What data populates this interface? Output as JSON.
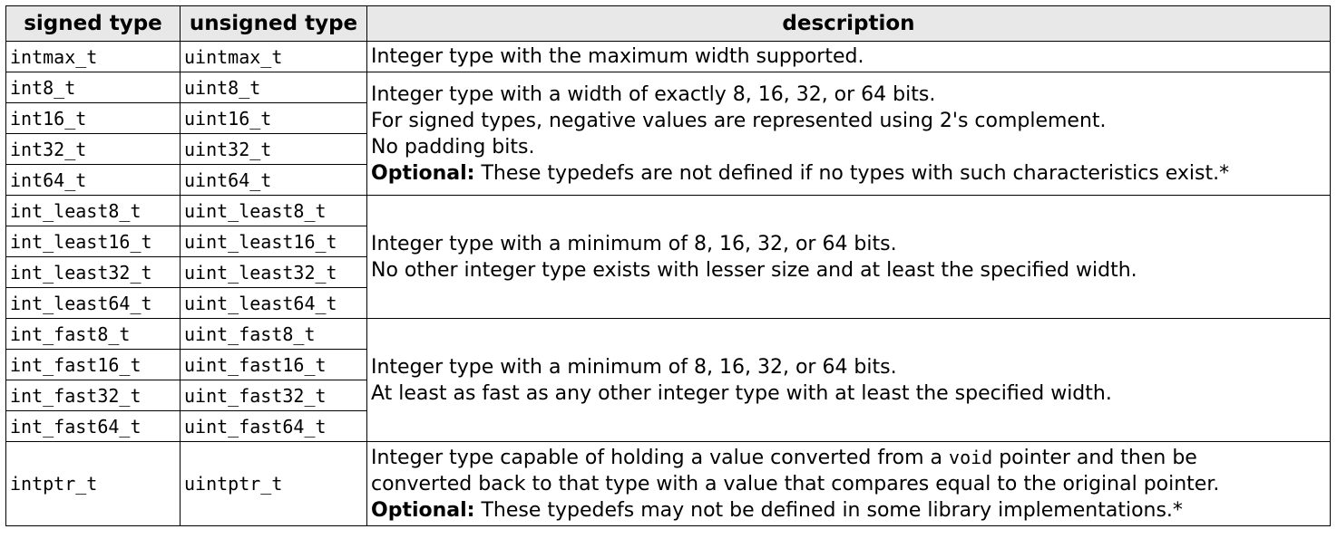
{
  "headers": {
    "signed": "signed type",
    "unsigned": "unsigned type",
    "description": "description"
  },
  "groups": [
    {
      "rows": [
        [
          "intmax_t",
          "uintmax_t"
        ]
      ],
      "desc": {
        "line1": "Integer type with the maximum width supported."
      }
    },
    {
      "rows": [
        [
          "int8_t",
          "uint8_t"
        ],
        [
          "int16_t",
          "uint16_t"
        ],
        [
          "int32_t",
          "uint32_t"
        ],
        [
          "int64_t",
          "uint64_t"
        ]
      ],
      "desc": {
        "line1": "Integer type with a width of exactly 8, 16, 32, or 64 bits.",
        "line2": "For signed types, negative values are represented using 2's complement.",
        "line3": "No padding bits.",
        "opt_label": "Optional:",
        "opt_text": " These typedefs are not defined if no types with such characteristics exist.*"
      }
    },
    {
      "rows": [
        [
          "int_least8_t",
          "uint_least8_t"
        ],
        [
          "int_least16_t",
          "uint_least16_t"
        ],
        [
          "int_least32_t",
          "uint_least32_t"
        ],
        [
          "int_least64_t",
          "uint_least64_t"
        ]
      ],
      "desc": {
        "line1": "Integer type with a minimum of 8, 16, 32, or 64 bits.",
        "line2": "No other integer type exists with lesser size and at least the specified width."
      }
    },
    {
      "rows": [
        [
          "int_fast8_t",
          "uint_fast8_t"
        ],
        [
          "int_fast16_t",
          "uint_fast16_t"
        ],
        [
          "int_fast32_t",
          "uint_fast32_t"
        ],
        [
          "int_fast64_t",
          "uint_fast64_t"
        ]
      ],
      "desc": {
        "line1": "Integer type with a minimum of 8, 16, 32, or 64 bits.",
        "line2": "At least as fast as any other integer type with at least the specified width."
      }
    },
    {
      "rows": [
        [
          "intptr_t",
          "uintptr_t"
        ]
      ],
      "desc": {
        "line1a": "Integer type capable of holding a value converted from a ",
        "line1code": "void",
        "line1b": " pointer and then be",
        "line2": "converted back to that type with a value that compares equal to the original pointer.",
        "opt_label": "Optional:",
        "opt_text": " These typedefs may not be defined in some library implementations.*"
      }
    }
  ]
}
